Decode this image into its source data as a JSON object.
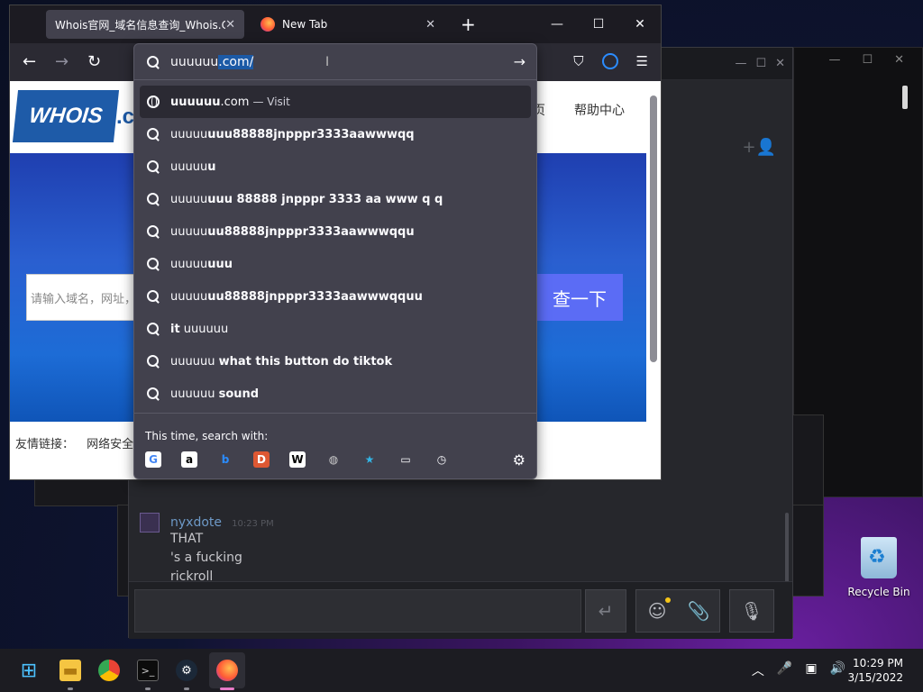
{
  "browser": {
    "tabs": [
      {
        "title": "Whois官网_域名信息查询_Whois.Co",
        "active": true
      },
      {
        "title": "New Tab",
        "active": false
      }
    ],
    "new_tab_label": "+",
    "window_controls": {
      "minimize": "—",
      "maximize": "☐",
      "close": "✕"
    },
    "nav": {
      "back": "←",
      "forward": "→",
      "reload": "↻",
      "go": "→"
    }
  },
  "urlbar": {
    "typed": "uuuuuu",
    "selected_completion": ".com/",
    "caret": "I"
  },
  "suggestions": [
    {
      "type": "visit",
      "bold": "uuuuuu",
      "rest": ".com",
      "suffix": "— Visit"
    },
    {
      "type": "search",
      "plain": "uuuuu",
      "bold": "uuu88888jnpppr3333aawwwqq"
    },
    {
      "type": "search",
      "plain": "uuuuu",
      "bold": "u"
    },
    {
      "type": "search",
      "plain": "uuuuu",
      "bold": "uuu 88888 jnpppr 3333 aa www q q"
    },
    {
      "type": "search",
      "plain": "uuuuu",
      "bold": "uu88888jnpppr3333aawwwqqu"
    },
    {
      "type": "search",
      "plain": "uuuuu",
      "bold": "uuu"
    },
    {
      "type": "search",
      "plain": "uuuuu",
      "bold": "uu88888jnpppr3333aawwwqquu"
    },
    {
      "type": "search",
      "bold": "it",
      "plain": " uuuuuu"
    },
    {
      "type": "search",
      "plain": "uuuuuu ",
      "bold": "what this button do tiktok"
    },
    {
      "type": "search",
      "plain": "uuuuuu ",
      "bold": "sound"
    }
  ],
  "search_with": {
    "label": "This time, search with:",
    "engines": [
      {
        "name": "google-icon",
        "glyph": "G",
        "color": "#4285f4",
        "bg": "#ffffff"
      },
      {
        "name": "amazon-icon",
        "glyph": "a",
        "color": "#000000",
        "bg": "#ffffff"
      },
      {
        "name": "bing-icon",
        "glyph": "b",
        "color": "#2b8cff",
        "bg": "transparent"
      },
      {
        "name": "duckduckgo-icon",
        "glyph": "D",
        "color": "#ffffff",
        "bg": "#de5833"
      },
      {
        "name": "wikipedia-icon",
        "glyph": "W",
        "color": "#000000",
        "bg": "#ffffff"
      },
      {
        "name": "search-engine-icon",
        "glyph": "◍",
        "color": "#cccccc",
        "bg": "transparent"
      },
      {
        "name": "bookmarks-icon",
        "glyph": "★",
        "color": "#33b5e5",
        "bg": "transparent"
      },
      {
        "name": "tabs-icon",
        "glyph": "▭",
        "color": "#fbfbfe",
        "bg": "transparent"
      },
      {
        "name": "history-icon",
        "glyph": "◷",
        "color": "#fbfbfe",
        "bg": "transparent"
      }
    ]
  },
  "page": {
    "logo_text": "WHOIS",
    "logo_tail": ".c",
    "nav_home": "页",
    "nav_help": "帮助中心",
    "search_placeholder": "请输入域名，网址，",
    "search_button": "查一下",
    "friend_links_label": "友情链接：",
    "friend_links_first": "网络安全"
  },
  "steam": {
    "message": {
      "author": "nyxdote",
      "time": "10:23 PM",
      "lines": [
        "THAT",
        "'s a fucking",
        "rickroll"
      ]
    },
    "send_glyph": "↵"
  },
  "desktop": {
    "recycle_bin_label": "Recycle Bin"
  },
  "taskbar": {
    "time": "10:29 PM",
    "date": "3/15/2022"
  }
}
